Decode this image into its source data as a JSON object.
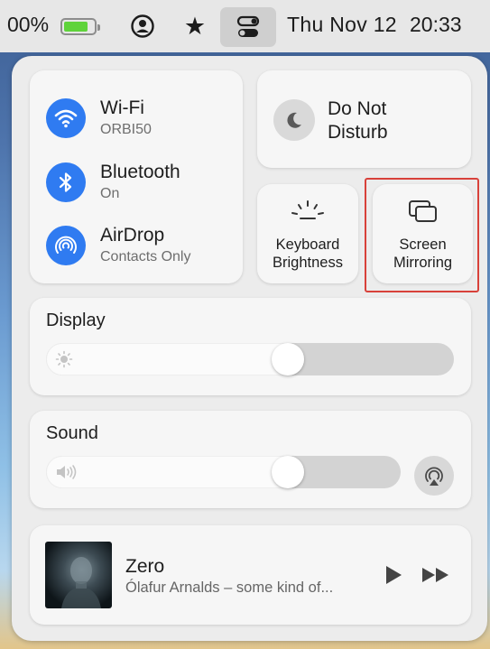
{
  "menubar": {
    "battery_percent": "00%",
    "battery_level": 0.8,
    "date": "Thu Nov 12",
    "time": "20:33",
    "icons": [
      "user-icon",
      "star-icon",
      "control-center-icon"
    ]
  },
  "network": {
    "wifi": {
      "title": "Wi-Fi",
      "subtitle": "ORBI50",
      "icon": "wifi-icon"
    },
    "bluetooth": {
      "title": "Bluetooth",
      "subtitle": "On",
      "icon": "bluetooth-icon"
    },
    "airdrop": {
      "title": "AirDrop",
      "subtitle": "Contacts Only",
      "icon": "airdrop-icon"
    }
  },
  "focus": {
    "line1": "Do Not",
    "line2": "Disturb",
    "icon": "moon-icon"
  },
  "keyboard_brightness": {
    "line1": "Keyboard",
    "line2": "Brightness",
    "icon": "keyboard-brightness-icon"
  },
  "screen_mirroring": {
    "line1": "Screen",
    "line2": "Mirroring",
    "icon": "screen-mirroring-icon",
    "highlighted": true,
    "highlight_color": "#d8413a"
  },
  "display": {
    "title": "Display",
    "level": 0.6,
    "icon": "sun-icon"
  },
  "sound": {
    "title": "Sound",
    "level": 0.7,
    "icon": "speaker-icon",
    "output_icon": "airplay-audio-icon"
  },
  "now_playing": {
    "title": "Zero",
    "artist": "Ólafur Arnalds – some kind of...",
    "controls": [
      "play-icon",
      "fast-forward-icon"
    ]
  },
  "colors": {
    "accent": "#2f7bf1",
    "battery": "#5fd33b"
  }
}
